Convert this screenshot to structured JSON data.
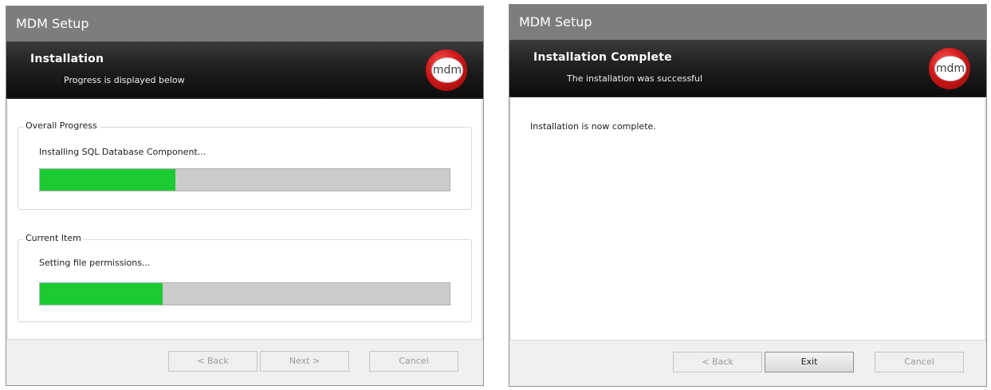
{
  "left_window": {
    "title": "MDM Setup",
    "banner": {
      "title": "Installation",
      "subtitle": "Progress is displayed below"
    },
    "logo": {
      "text": "mdm",
      "color": "#d01818"
    },
    "overall": {
      "legend": "Overall Progress",
      "status": "Installing SQL Database Component...",
      "progress": 0.33
    },
    "current": {
      "legend": "Current Item",
      "status": "Setting file permissions...",
      "progress": 0.3
    },
    "buttons": {
      "back": "< Back",
      "next": "Next >",
      "cancel": "Cancel"
    }
  },
  "right_window": {
    "title": "MDM Setup",
    "banner": {
      "title": "Installation Complete",
      "subtitle": "The installation was successful"
    },
    "logo": {
      "text": "mdm",
      "color": "#d01818"
    },
    "message": "Installation is now complete.",
    "buttons": {
      "back": "< Back",
      "exit": "Exit",
      "cancel": "Cancel"
    }
  },
  "colors": {
    "progress_fill": "#1ccb33",
    "progress_track": "#cbcbcb",
    "title_bar": "#7d7d7d",
    "banner": "#1a1a1a"
  },
  "icons": [
    "mdm-logo-icon"
  ]
}
